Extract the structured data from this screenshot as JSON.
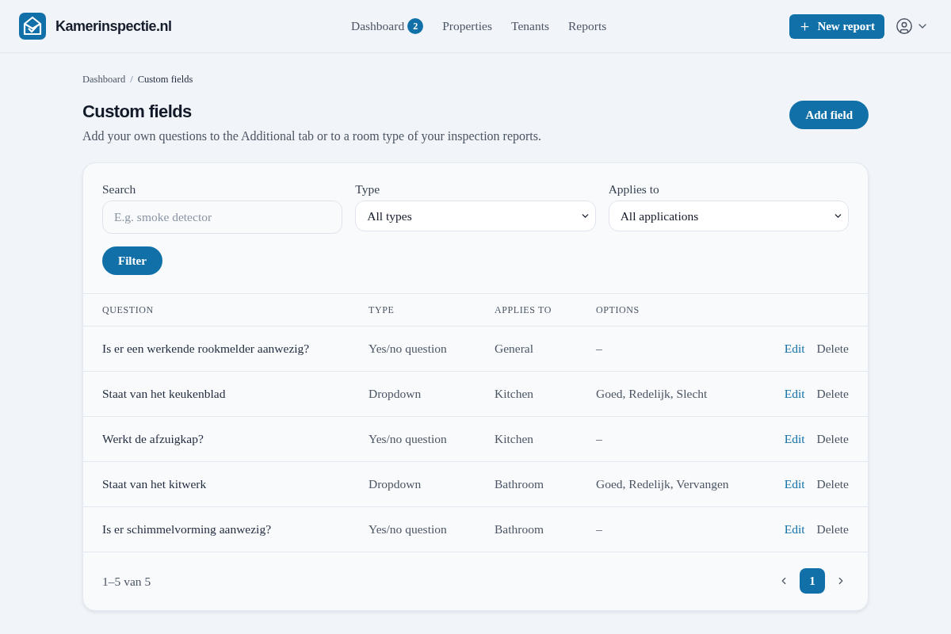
{
  "header": {
    "logo": "Kamerinspectie.nl",
    "nav": [
      {
        "label": "Dashboard",
        "badge": "2",
        "selected": false
      },
      {
        "label": "Properties",
        "selected": false
      },
      {
        "label": "Tenants",
        "selected": false
      },
      {
        "label": "Reports",
        "selected": false
      }
    ],
    "new_report_button": "New report"
  },
  "breadcrumb": {
    "items": [
      "Dashboard",
      "Custom fields"
    ],
    "separator": "/"
  },
  "page": {
    "title": "Custom fields",
    "subtitle": "Add your own questions to the Additional tab or to a room type of your inspection reports.",
    "add_button": "Add field"
  },
  "filters": {
    "search": {
      "label": "Search",
      "placeholder": "E.g. smoke detector"
    },
    "type": {
      "label": "Type",
      "value": "All types"
    },
    "applies_to": {
      "label": "Applies to",
      "value": "All applications"
    },
    "button": "Filter"
  },
  "table": {
    "columns": [
      "QUESTION",
      "TYPE",
      "APPLIES TO",
      "OPTIONS"
    ],
    "rows": [
      {
        "question": "Is er een werkende rookmelder aanwezig?",
        "type": "Yes/no question",
        "applies_to": "General",
        "options": "–",
        "actions": [
          "Edit",
          "Delete"
        ]
      },
      {
        "question": "Staat van het keukenblad",
        "type": "Dropdown",
        "applies_to": "Kitchen",
        "options": "Goed, Redelijk, Slecht",
        "actions": [
          "Edit",
          "Delete"
        ]
      },
      {
        "question": "Werkt de afzuigkap?",
        "type": "Yes/no question",
        "applies_to": "Kitchen",
        "options": "–",
        "actions": [
          "Edit",
          "Delete"
        ]
      },
      {
        "question": "Staat van het kitwerk",
        "type": "Dropdown",
        "applies_to": "Bathroom",
        "options": "Goed, Redelijk, Vervangen",
        "actions": [
          "Edit",
          "Delete"
        ]
      },
      {
        "question": "Is er schimmelvorming aanwezig?",
        "type": "Yes/no question",
        "applies_to": "Bathroom",
        "options": "–",
        "actions": [
          "Edit",
          "Delete"
        ]
      }
    ]
  },
  "footer": {
    "range": "1–5 van 5",
    "pages": [
      {
        "label": "1",
        "selected": true
      }
    ]
  }
}
